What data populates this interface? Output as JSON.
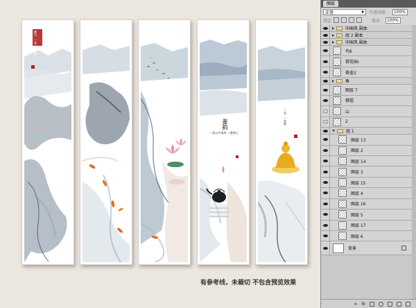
{
  "caption": "有参考线，未裁切 不包含预览效果",
  "panel1": {
    "seal_text": "佛日 · 一花 · 一世界"
  },
  "panel4": {
    "title": "墨韵",
    "poem": "一壶山中清茶 一盏禅心"
  },
  "panel5": {
    "seal_text": "一花 · 一世界"
  },
  "layers_panel": {
    "tab_label": "图层",
    "blend_mode": "正常",
    "opacity_label": "不透明度",
    "opacity_value": "100%",
    "lock_label": "锁定",
    "fill_label": "填充",
    "fill_value": "100%",
    "layers": [
      {
        "name": "中国风 副本",
        "kind": "group",
        "visible": true,
        "indent": 0,
        "open": false
      },
      {
        "name": "组 2 副本",
        "kind": "group",
        "visible": true,
        "indent": 0,
        "open": false
      },
      {
        "name": "中国风 副本",
        "kind": "group",
        "visible": true,
        "indent": 0,
        "open": false
      },
      {
        "name": "鸟6",
        "kind": "layer",
        "visible": true,
        "indent": 0
      },
      {
        "name": "荷花8b",
        "kind": "layer",
        "visible": true,
        "indent": 0
      },
      {
        "name": "茶壶2",
        "kind": "layer",
        "visible": true,
        "indent": 0
      },
      {
        "name": "鱼",
        "kind": "group",
        "visible": true,
        "indent": 0,
        "open": false
      },
      {
        "name": "图层 7",
        "kind": "layer",
        "visible": true,
        "indent": 0
      },
      {
        "name": "佛祖",
        "kind": "layer",
        "visible": true,
        "indent": 0
      },
      {
        "name": "山",
        "kind": "layer",
        "visible": false,
        "indent": 0
      },
      {
        "name": "2",
        "kind": "layer",
        "visible": false,
        "indent": 0
      },
      {
        "name": "组 1",
        "kind": "group",
        "visible": true,
        "indent": 0,
        "open": true
      },
      {
        "name": "图层 13",
        "kind": "layer",
        "visible": true,
        "indent": 1
      },
      {
        "name": "图层 2",
        "kind": "layer",
        "visible": true,
        "indent": 1
      },
      {
        "name": "图层 14",
        "kind": "layer",
        "visible": true,
        "indent": 1
      },
      {
        "name": "图层 3",
        "kind": "layer",
        "visible": true,
        "indent": 1
      },
      {
        "name": "图层 15",
        "kind": "layer",
        "visible": true,
        "indent": 1
      },
      {
        "name": "图层 4",
        "kind": "layer",
        "visible": true,
        "indent": 1
      },
      {
        "name": "图层 16",
        "kind": "layer",
        "visible": true,
        "indent": 1
      },
      {
        "name": "图层 5",
        "kind": "layer",
        "visible": true,
        "indent": 1
      },
      {
        "name": "图层 17",
        "kind": "layer",
        "visible": true,
        "indent": 1
      },
      {
        "name": "图层 6",
        "kind": "layer",
        "visible": true,
        "indent": 1
      },
      {
        "name": "背景",
        "kind": "background",
        "visible": true,
        "indent": 0,
        "locked": true
      }
    ]
  }
}
